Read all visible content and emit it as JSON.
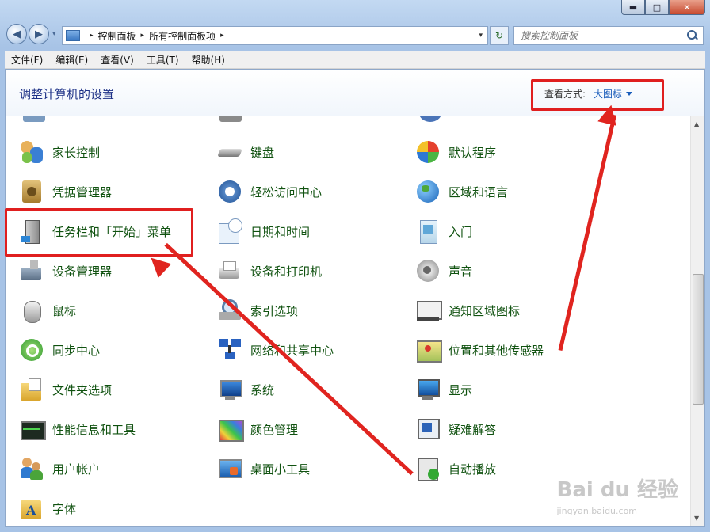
{
  "window": {
    "minimize": "▬",
    "maximize": "□",
    "close": "✕"
  },
  "nav": {
    "back": "◀",
    "forward": "▶",
    "dropdown": "▾"
  },
  "address": {
    "breadcrumb": [
      "控制面板",
      "所有控制面板项"
    ],
    "sep": "▸",
    "dropdown": "▾"
  },
  "refresh": "↻",
  "search": {
    "placeholder": "搜索控制面板"
  },
  "menu": [
    "文件(F)",
    "编辑(E)",
    "查看(V)",
    "工具(T)",
    "帮助(H)"
  ],
  "header": {
    "title": "调整计算机的设置",
    "view_label": "查看方式:",
    "view_value": "大图标"
  },
  "items": {
    "col1": [
      "家长控制",
      "凭据管理器",
      "任务栏和「开始」菜单",
      "设备管理器",
      "鼠标",
      "同步中心",
      "文件夹选项",
      "性能信息和工具",
      "用户帐户",
      "字体"
    ],
    "col2": [
      "键盘",
      "轻松访问中心",
      "日期和时间",
      "设备和打印机",
      "索引选项",
      "网络和共享中心",
      "系统",
      "颜色管理",
      "桌面小工具"
    ],
    "col3": [
      "默认程序",
      "区域和语言",
      "入门",
      "声音",
      "通知区域图标",
      "位置和其他传感器",
      "显示",
      "疑难解答",
      "自动播放"
    ]
  },
  "watermark": {
    "brand": "Bai du 经验",
    "url": "jingyan.baidu.com"
  },
  "colors": {
    "highlight": "#e01f1f",
    "link": "#105210",
    "title": "#1e3287"
  }
}
